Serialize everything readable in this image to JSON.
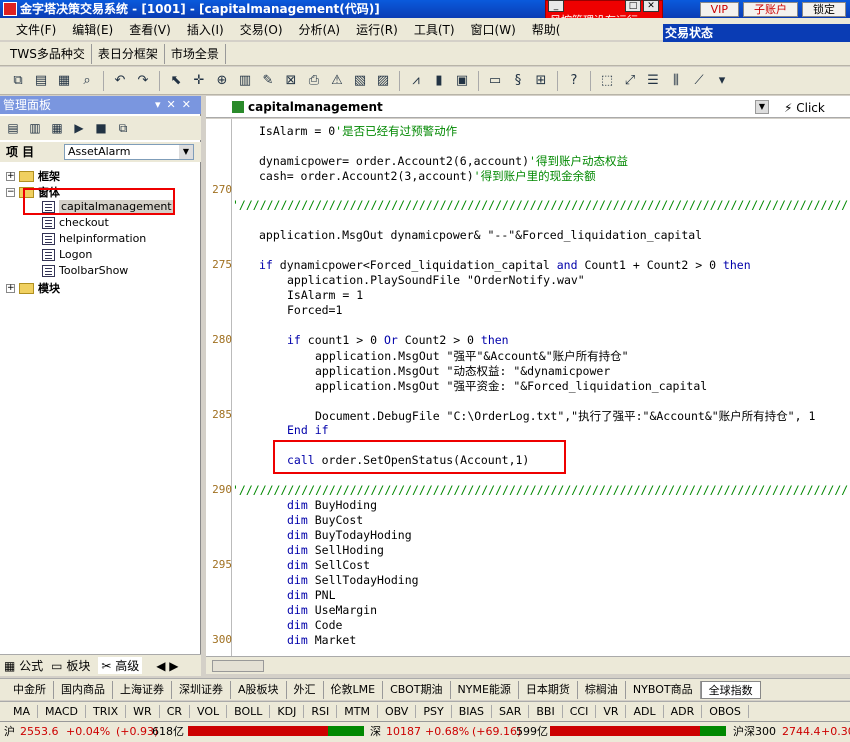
{
  "window": {
    "title": "金字塔决策交易系统 - [1001] - [capitalmanagement(代码)]",
    "top_buttons": [
      "VIP",
      "子账户",
      "锁定"
    ],
    "risk_message": "风控管理没有运行",
    "trade_status_label": "交易状态",
    "min_icon": "_",
    "max_icon": "□",
    "close_icon": "✕"
  },
  "menu": [
    "文件(F)",
    "编辑(E)",
    "查看(V)",
    "插入(I)",
    "交易(O)",
    "分析(A)",
    "运行(R)",
    "工具(T)",
    "窗口(W)",
    "帮助("
  ],
  "quickbar": [
    "TWS多品种交",
    "表日分框架",
    "市场全景"
  ],
  "left_panel": {
    "title": "管理面板",
    "item_label": "项  目",
    "selected_combo": "AssetAlarm",
    "tree": {
      "frame": "框架",
      "window": "窗体",
      "children": [
        "capitalmanagement",
        "checkout",
        "helpinformation",
        "Logon",
        "ToolbarShow"
      ],
      "module": "模块"
    },
    "bottom_tabs": [
      "公式",
      "板块",
      "高级"
    ]
  },
  "editor": {
    "tab_title": "capitalmanagement",
    "click_label": "Click",
    "line_numbers": [
      "270",
      "275",
      "280",
      "285",
      "290",
      "295",
      "300"
    ],
    "lines": {
      "l1": "IsAlarm = 0",
      "l1c": "'是否已经有过预警动作",
      "l2": "dynamicpower= order.Account2(6,account)",
      "l2c": "'得到账户动态权益",
      "l3": "cash= order.Account2(3,account)",
      "l3c": "'得到账户里的现金余额",
      "sep": "'////////////////////////////////////////////////////////////////////////////////////////",
      "l4": "application.MsgOut dynamicpower& \"--\"&Forced_liquidation_capital",
      "l5a": "if",
      "l5b": " dynamicpower<Forced_liquidation_capital ",
      "l5c": "and",
      "l5d": " Count1 + Count2 > 0 ",
      "l5e": "then",
      "l6": "application.PlaySoundFile \"OrderNotify.wav\"",
      "l7": "IsAlarm = 1",
      "l8": "Forced=1",
      "l9a": "if",
      "l9b": " count1 > 0 ",
      "l9c": "Or",
      "l9d": " Count2 > 0 ",
      "l9e": "then",
      "l10": "application.MsgOut \"强平\"&Account&\"账户所有持仓\"",
      "l11": "application.MsgOut \"动态权益: \"&dynamicpower",
      "l12": "application.MsgOut \"强平资金: \"&Forced_liquidation_capital",
      "l13": "Document.DebugFile \"C:\\OrderLog.txt\",\"执行了强平:\"&Account&\"账户所有持仓\", 1",
      "l14": "End if",
      "l15a": "call",
      "l15b": " order.SetOpenStatus(Account,1)",
      "dim": "dim",
      "dims": [
        "BuyHoding",
        "BuyCost",
        "BuyTodayHoding",
        "SellHoding",
        "SellCost",
        "SellTodayHoding",
        "PNL",
        "UseMargin",
        "Code",
        "Market"
      ]
    }
  },
  "market_tabs": [
    "中金所",
    "国内商品",
    "上海证券",
    "深圳证券",
    "A股板块",
    "外汇",
    "伦敦LME",
    "CBOT期油",
    "NYME能源",
    "日本期货",
    "棕榈油",
    "NYBOT商品",
    "全球指数"
  ],
  "indicators": [
    "MA",
    "MACD",
    "TRIX",
    "WR",
    "CR",
    "VOL",
    "BOLL",
    "KDJ",
    "RSI",
    "MTM",
    "OBV",
    "PSY",
    "BIAS",
    "SAR",
    "BBI",
    "CCI",
    "VR",
    "ADL",
    "ADR",
    "OBOS"
  ],
  "status": {
    "sh_label": "沪",
    "sh_value": "2553.6",
    "sh_change": "+0.04%",
    "sh_delta": "(+0.93)",
    "sh_vol": "618亿",
    "sz_label": "深",
    "sz_value": "10187",
    "sz_change": "+0.68%",
    "sz_delta": "(+69.16)",
    "sz_vol": "599亿",
    "hs_label": "沪深300",
    "hs_value": "2744.4",
    "hs_change": "+0.30",
    "up_color": "#cc0000",
    "down_color": "#008800"
  }
}
